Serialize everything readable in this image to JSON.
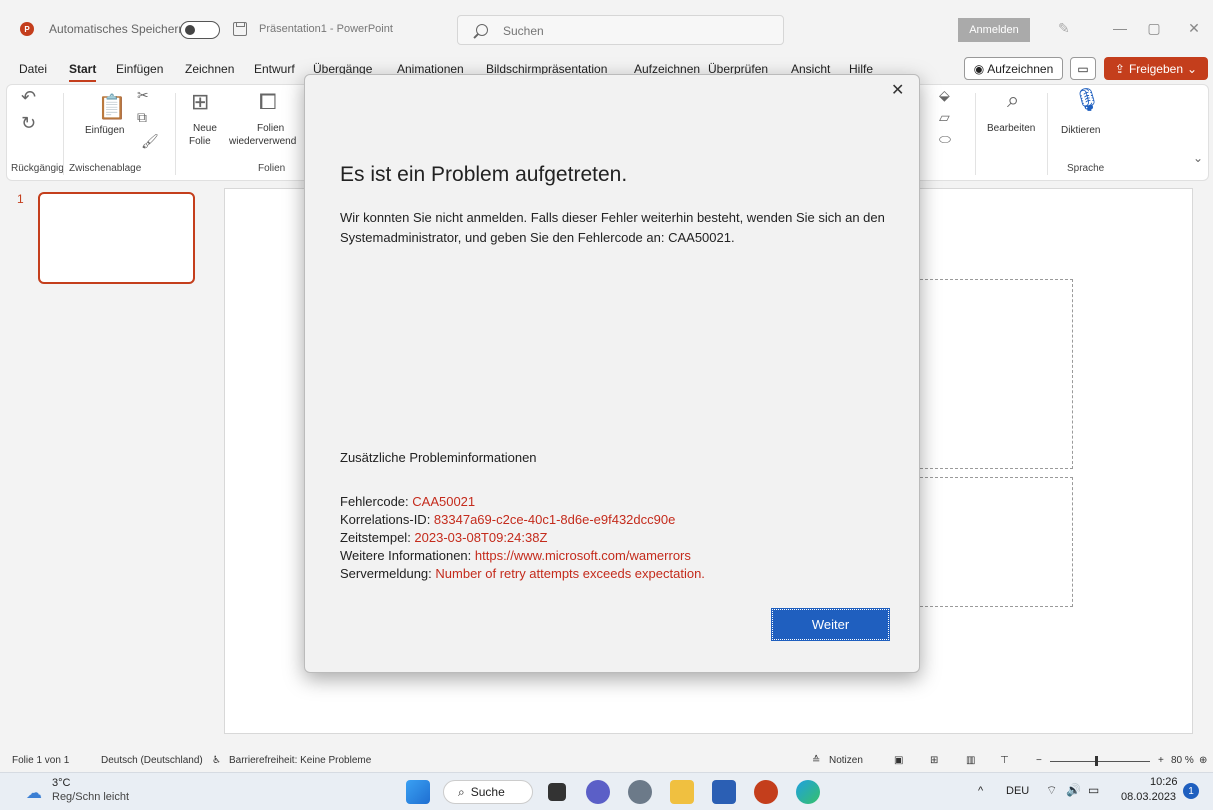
{
  "titlebar": {
    "autosave_label": "Automatisches Speichern",
    "document_title": "Präsentation1 - PowerPoint",
    "search_placeholder": "Suchen",
    "signin_label": "Anmelden"
  },
  "menu": {
    "tabs": [
      "Datei",
      "Start",
      "Einfügen",
      "Zeichnen",
      "Entwurf",
      "Übergänge",
      "Animationen",
      "Bildschirmpräsentation",
      "Aufzeichnen",
      "Überprüfen",
      "Ansicht",
      "Hilfe"
    ],
    "active_tab": "Start",
    "record_label": "Aufzeichnen",
    "share_label": "Freigeben"
  },
  "ribbon": {
    "undo_group": "Rückgängig",
    "paste_label": "Einfügen",
    "clipboard_group": "Zwischenablage",
    "new_slide_line1": "Neue",
    "new_slide_line2": "Folie",
    "reuse_line1": "Folien",
    "reuse_line2": "wiederverwend",
    "slides_group": "Folien",
    "edit_label": "Bearbeiten",
    "dictate_label": "Diktieren",
    "language_group": "Sprache"
  },
  "thumbnails": {
    "slide_number": "1"
  },
  "statusbar": {
    "slide_info": "Folie 1 von 1",
    "language": "Deutsch (Deutschland)",
    "accessibility": "Barrierefreiheit: Keine Probleme",
    "notes_label": "Notizen",
    "zoom": "80 %"
  },
  "taskbar": {
    "weather_temp": "3°C",
    "weather_desc": "Reg/Schn leicht",
    "search_label": "Suche",
    "lang": "DEU",
    "time": "10:26",
    "date": "08.03.2023",
    "notification_count": "1"
  },
  "dialog": {
    "heading": "Es ist ein Problem aufgetreten.",
    "message": "Wir konnten Sie nicht anmelden. Falls dieser Fehler weiterhin besteht, wenden Sie sich an den Systemadministrator, und geben Sie den Fehlercode an: CAA50021.",
    "additional_info_title": "Zusätzliche Probleminformationen",
    "error_code_label": "Fehlercode: ",
    "error_code_value": "CAA50021",
    "correlation_label": "Korrelations-ID: ",
    "correlation_value": "83347a69-c2ce-40c1-8d6e-e9f432dcc90e",
    "timestamp_label": "Zeitstempel: ",
    "timestamp_value": "2023-03-08T09:24:38Z",
    "more_info_label": "Weitere Informationen: ",
    "more_info_value": "https://www.microsoft.com/wamerrors",
    "server_label": "Servermeldung: ",
    "server_value": "Number of retry attempts exceeds expectation.",
    "continue_label": "Weiter",
    "close_symbol": "✕"
  },
  "colors": {
    "accent": "#c43e1c",
    "error_text": "#c42b1c",
    "primary_button": "#1f5fbf"
  }
}
